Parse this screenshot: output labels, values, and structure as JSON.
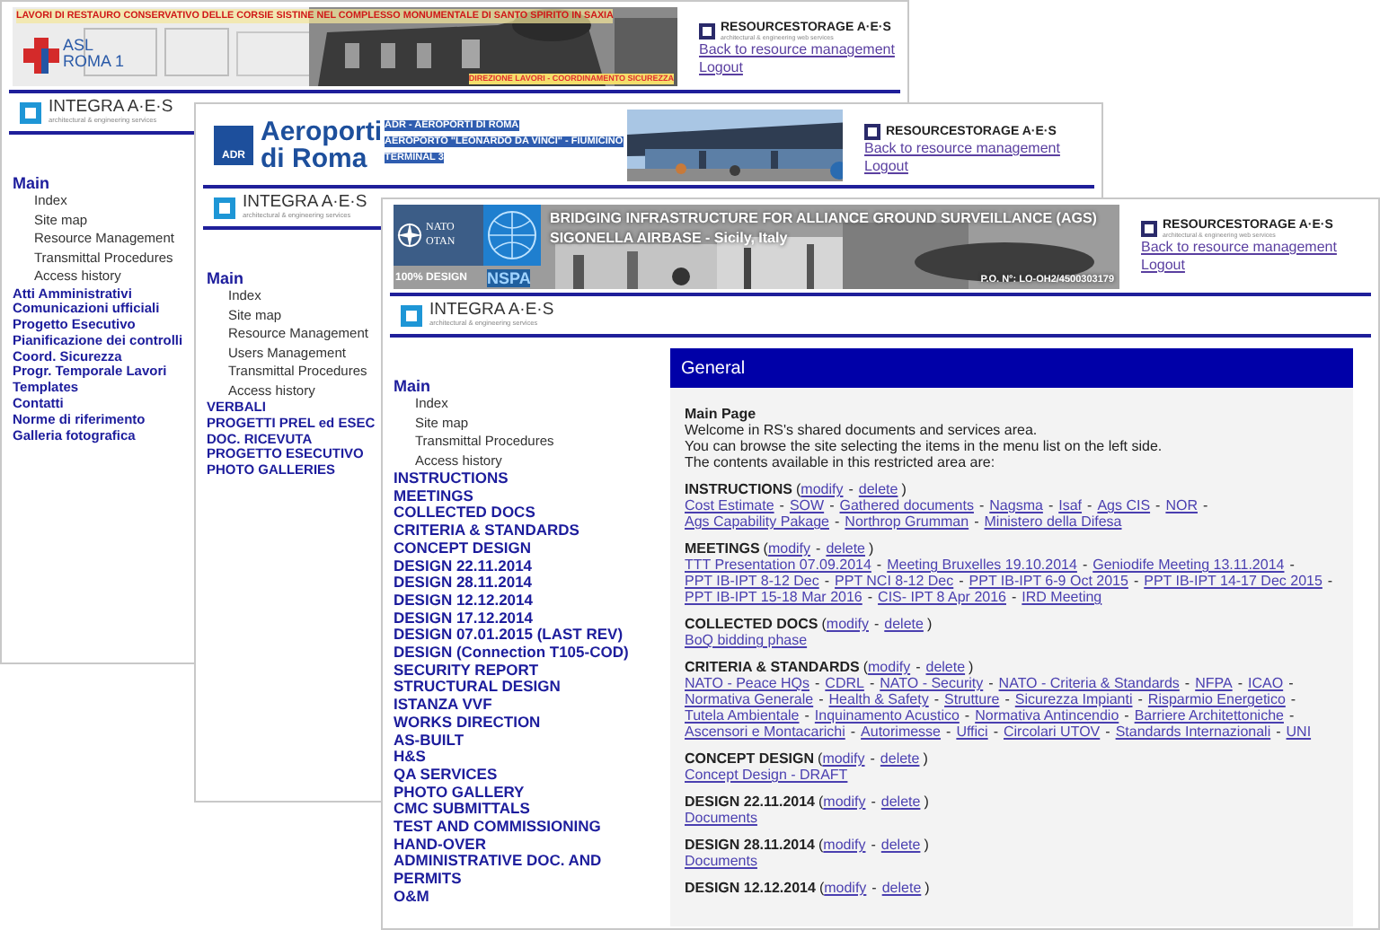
{
  "punctuation": {
    "open": "(",
    "close": ")",
    "separator": "-"
  },
  "windows": [
    {
      "kind": "asl",
      "banner": {
        "title": "LAVORI DI RESTAURO CONSERVATIVO DELLE CORSIE SISTINE NEL COMPLESSO MONUMENTALE DI SANTO SPIRITO IN SAXIA",
        "logo_lines": [
          "ASL",
          "ROMA 1"
        ],
        "caption": "DIREZIONE LAVORI - COORDINAMENTO SICUREZZA"
      },
      "resource_storage": {
        "brand": "RESOURCESTORAGE A·E·S",
        "tagline": "architectural & engineering web services",
        "links": [
          "Back to resource management",
          "Logout"
        ]
      },
      "logo": {
        "name": "INTEGRA A·E·S",
        "tagline": "architectural & engineering services"
      },
      "menu": {
        "heading": "Main",
        "items": [
          "Index",
          "Site map",
          "Resource Management",
          "Transmittal Procedures",
          "Access history"
        ],
        "sections": [
          "Atti Amministrativi",
          "Comunicazioni ufficiali",
          "Progetto Esecutivo",
          "Pianificazione dei controlli",
          "Coord. Sicurezza",
          "Progr. Temporale Lavori",
          "Templates",
          "Contatti",
          "Norme di riferimento",
          "Galleria fotografica"
        ]
      }
    },
    {
      "kind": "adr",
      "banner": {
        "logo_mark": "ADR",
        "logo_lines": [
          "Aeroporti",
          "di Roma"
        ],
        "lines": [
          "ADR - AEROPORTI DI ROMA",
          "AEROPORTO \"LEONARDO DA VINCI\" - FIUMICINO",
          "TERMINAL 3"
        ]
      },
      "resource_storage": {
        "brand": "RESOURCESTORAGE A·E·S",
        "links": [
          "Back to resource management",
          "Logout"
        ]
      },
      "logo": {
        "name": "INTEGRA A·E·S",
        "tagline": "architectural & engineering services"
      },
      "menu": {
        "heading": "Main",
        "items": [
          "Index",
          "Site map",
          "Resource Management",
          "Users Management",
          "Transmittal Procedures",
          "Access history"
        ],
        "sections": [
          "VERBALI",
          "PROGETTI PREL ed ESEC",
          "DOC. RICEVUTA",
          "PROGETTO ESECUTIVO",
          "PHOTO GALLERIES"
        ]
      }
    },
    {
      "kind": "nato",
      "banner": {
        "emblem_lines": [
          "NATO",
          "OTAN"
        ],
        "badge": "100% DESIGN",
        "agency": "NSPA",
        "title": "BRIDGING INFRASTRUCTURE FOR ALLIANCE GROUND SURVEILLANCE (AGS)",
        "subtitle": "SIGONELLA AIRBASE - Sicily, Italy",
        "order": "P.O. N°: LO-OH2/4500303179"
      },
      "resource_storage": {
        "brand": "RESOURCESTORAGE A·E·S",
        "tagline": "architectural & engineering web services",
        "links": [
          "Back to resource management",
          "Logout"
        ]
      },
      "logo": {
        "name": "INTEGRA A·E·S",
        "tagline": "architectural & engineering services"
      },
      "menu": {
        "heading": "Main",
        "items": [
          "Index",
          "Site map",
          "Transmittal Procedures",
          "Access history"
        ],
        "sections": [
          "INSTRUCTIONS",
          "MEETINGS",
          "COLLECTED DOCS",
          "CRITERIA & STANDARDS",
          "CONCEPT DESIGN",
          "DESIGN 22.11.2014",
          "DESIGN 28.11.2014",
          "DESIGN 12.12.2014",
          "DESIGN 17.12.2014",
          "DESIGN 07.01.2015 (LAST REV)",
          "DESIGN (Connection T105-COD)",
          "SECURITY REPORT",
          "STRUCTURAL DESIGN",
          "ISTANZA VVF",
          "WORKS DIRECTION",
          "AS-BUILT",
          "H&S",
          "QA SERVICES",
          "PHOTO GALLERY",
          "CMC SUBMITTALS",
          "TEST AND COMMISSIONING",
          "HAND-OVER",
          "ADMINISTRATIVE DOC. AND PERMITS",
          "O&M"
        ]
      },
      "content": {
        "header": "General",
        "heading": "Main Page",
        "intro": [
          "Welcome in RS's shared documents and services area.",
          "You can browse the site selecting the items in the menu list on the left side.",
          "The contents available in this restricted area are:"
        ],
        "sections": [
          {
            "title": "INSTRUCTIONS",
            "actions": [
              "modify",
              "delete"
            ],
            "links": [
              "Cost Estimate",
              "SOW",
              "Gathered documents",
              "Nagsma",
              "Isaf",
              "Ags CIS",
              "NOR",
              "Ags Capability Pakage",
              "Northrop Grumman",
              "Ministero della Difesa"
            ]
          },
          {
            "title": "MEETINGS",
            "actions": [
              "modify",
              "delete"
            ],
            "links": [
              "TTT Presentation 07.09.2014",
              "Meeting Bruxelles 19.10.2014",
              "Geniodife Meeting 13.11.2014",
              "PPT IB-IPT 8-12 Dec",
              "PPT NCI 8-12 Dec",
              "PPT IB-IPT 6-9 Oct 2015",
              "PPT IB-IPT 14-17 Dec 2015",
              "PPT IB-IPT 15-18 Mar 2016",
              "CIS- IPT 8 Apr 2016",
              "IRD Meeting"
            ]
          },
          {
            "title": "COLLECTED DOCS",
            "actions": [
              "modify",
              "delete"
            ],
            "links": [
              "BoQ bidding phase"
            ]
          },
          {
            "title": "CRITERIA & STANDARDS",
            "actions": [
              "modify",
              "delete"
            ],
            "links": [
              "NATO - Peace HQs",
              "CDRL",
              "NATO - Security",
              "NATO - Criteria & Standards",
              "NFPA",
              "ICAO",
              "Normativa Generale",
              "Health & Safety",
              "Strutture",
              "Sicurezza Impianti",
              "Risparmio Energetico",
              "Tutela Ambientale",
              "Inquinamento Acustico",
              "Normativa Antincendio",
              "Barriere Architettoniche",
              "Ascensori e Montacarichi",
              "Autorimesse",
              "Uffici",
              "Circolari UTOV",
              "Standards Internazionali",
              "UNI"
            ]
          },
          {
            "title": "CONCEPT DESIGN",
            "actions": [
              "modify",
              "delete"
            ],
            "links": [
              "Concept Design - DRAFT"
            ]
          },
          {
            "title": "DESIGN 22.11.2014",
            "actions": [
              "modify",
              "delete"
            ],
            "links": [
              "Documents"
            ]
          },
          {
            "title": "DESIGN 28.11.2014",
            "actions": [
              "modify",
              "delete"
            ],
            "links": [
              "Documents"
            ]
          },
          {
            "title": "DESIGN 12.12.2014",
            "actions": [
              "modify",
              "delete"
            ]
          }
        ]
      }
    }
  ]
}
